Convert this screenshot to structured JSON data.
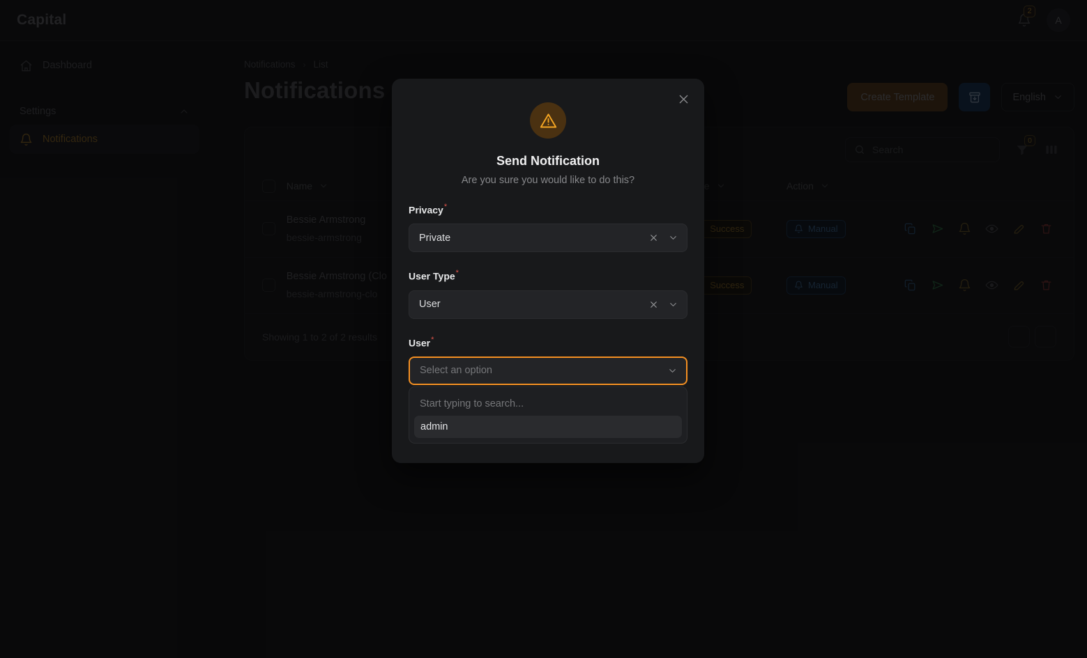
{
  "topbar": {
    "brand": "Capital",
    "notification_count": "2",
    "avatar_initial": "A"
  },
  "sidebar": {
    "items": [
      {
        "label": "Dashboard",
        "icon": "home-icon"
      }
    ],
    "group": {
      "label": "Settings",
      "icon": "chevron-up-icon"
    },
    "group_items": [
      {
        "label": "Notifications",
        "icon": "bell-icon",
        "active": true
      }
    ]
  },
  "breadcrumb": {
    "root": "Notifications",
    "separator": "›",
    "current": "List"
  },
  "page": {
    "title": "Notifications",
    "create_button": "Create Template",
    "archive_icon": "archive-download-icon",
    "language": "English"
  },
  "toolbar": {
    "search_placeholder": "Search",
    "search_value": "",
    "filter_badge": "0",
    "filter_icon": "filter-icon",
    "columns_icon": "columns-icon"
  },
  "table": {
    "columns": [
      "Name",
      "Type",
      "Action"
    ],
    "rows": [
      {
        "name": "Bessie Armstrong",
        "slug": "bessie-armstrong",
        "type": "Success",
        "action": "Manual",
        "icons": [
          "copy-icon",
          "send-icon",
          "bell-icon",
          "eye-icon",
          "edit-icon",
          "delete-icon"
        ]
      },
      {
        "name": "Bessie Armstrong (Clo",
        "slug": "bessie-armstrong-clo",
        "type": "Success",
        "action": "Manual",
        "icons": [
          "copy-icon",
          "send-icon",
          "bell-icon",
          "eye-icon",
          "edit-icon",
          "delete-icon"
        ]
      }
    ],
    "footer_text": "Showing 1 to 2 of 2 results"
  },
  "modal": {
    "icon": "warning-triangle-icon",
    "title": "Send Notification",
    "subtitle": "Are you sure you would like to do this?",
    "close_icon": "close-icon",
    "fields": [
      {
        "label": "Privacy",
        "required": "*",
        "value": "Private",
        "clearable": true
      },
      {
        "label": "User Type",
        "required": "*",
        "value": "User",
        "clearable": true
      },
      {
        "label": "User",
        "required": "*",
        "placeholder": "Select an option",
        "clearable": false
      }
    ],
    "dropdown": {
      "search_placeholder": "Start typing to search...",
      "options": [
        "admin"
      ]
    }
  },
  "colors": {
    "accent_orange": "#f59022",
    "brand_amber": "#a87b25",
    "blue": "#3d6f9e",
    "green": "#3f8f55",
    "red": "#a3413c",
    "required_red": "#e2544a"
  }
}
